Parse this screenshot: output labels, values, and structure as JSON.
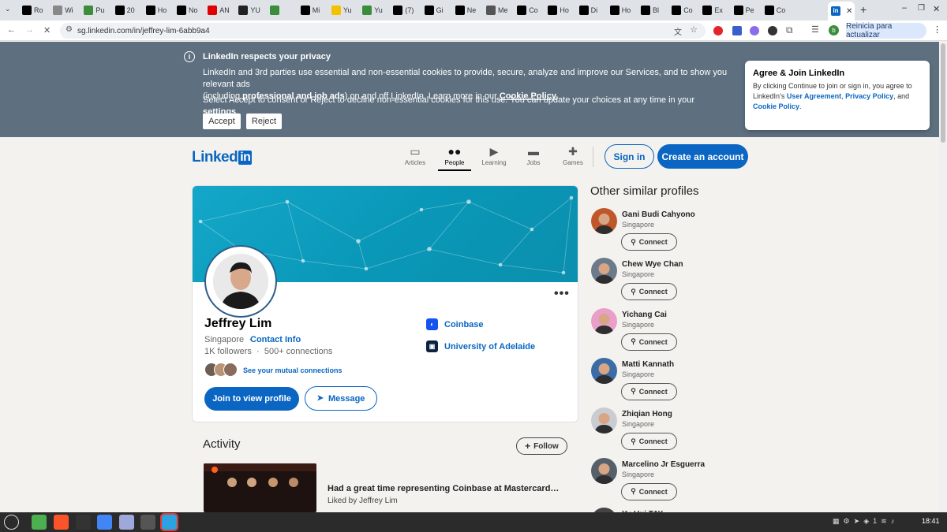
{
  "browser": {
    "tabs": [
      {
        "label": "Ro",
        "icon": "x-icon",
        "color": "#000000"
      },
      {
        "label": "Wi",
        "icon": "wikipedia-icon",
        "color": "#888888"
      },
      {
        "label": "Pu",
        "icon": "puzzle-icon",
        "color": "#3b8c3b"
      },
      {
        "label": "20",
        "icon": "x-circle-icon",
        "color": "#000000"
      },
      {
        "label": "Ho",
        "icon": "x-icon",
        "color": "#000000"
      },
      {
        "label": "No",
        "icon": "x-icon",
        "color": "#000000"
      },
      {
        "label": "AN",
        "icon": "youtube-icon",
        "color": "#e00000"
      },
      {
        "label": "YU",
        "icon": "threads-icon",
        "color": "#222222"
      },
      {
        "label": "",
        "icon": "puzzle-icon",
        "color": "#3b8c3b"
      },
      {
        "label": "Mi",
        "icon": "x-icon",
        "color": "#000000"
      },
      {
        "label": "Yu",
        "icon": "notes-icon",
        "color": "#f2c200"
      },
      {
        "label": "Yu",
        "icon": "puzzle-icon",
        "color": "#3b8c3b"
      },
      {
        "label": "(7)",
        "icon": "tiktok-icon",
        "color": "#000000"
      },
      {
        "label": "Gi",
        "icon": "x-icon",
        "color": "#000000"
      },
      {
        "label": "Ne",
        "icon": "x-icon",
        "color": "#000000"
      },
      {
        "label": "Me",
        "icon": "globe-icon",
        "color": "#555555"
      },
      {
        "label": "Co",
        "icon": "x-icon",
        "color": "#000000"
      },
      {
        "label": "Ho",
        "icon": "x-icon",
        "color": "#000000"
      },
      {
        "label": "Di",
        "icon": "x-icon",
        "color": "#000000"
      },
      {
        "label": "Ho",
        "icon": "x-icon",
        "color": "#000000"
      },
      {
        "label": "Bl",
        "icon": "x-icon",
        "color": "#000000"
      },
      {
        "label": "Co",
        "icon": "x-icon",
        "color": "#000000"
      },
      {
        "label": "Ex",
        "icon": "x-icon",
        "color": "#000000"
      },
      {
        "label": "Pe",
        "icon": "x-icon",
        "color": "#000000"
      },
      {
        "label": "Co",
        "icon": "x-icon",
        "color": "#000000"
      }
    ],
    "active_tab_icon": "linkedin-icon",
    "new_tab": "+",
    "url": "sg.linkedin.com/in/jeffrey-lim-6abb9a4",
    "restart_label": "Reinicia para actualizar",
    "profile_initial": "b"
  },
  "cookie_banner": {
    "title": "LinkedIn respects your privacy",
    "line1": "LinkedIn and 3rd parties use essential and non-essential cookies to provide, secure, analyze and improve our Services, and to show you relevant ads",
    "line2_pre": "(including ",
    "line2_bold": "professional and job ads",
    "line2_mid": ") on and off LinkedIn. Learn more in our ",
    "line2_link": "Cookie Policy",
    "line2_end": ".",
    "line3_pre": "Select Accept to consent or Reject to decline non-essential cookies for this use. You can update your choices at any time in your ",
    "line3_link": "settings",
    "line3_end": ".",
    "accept": "Accept",
    "reject": "Reject"
  },
  "join_card": {
    "title": "Agree & Join LinkedIn",
    "text_pre": "By clicking Continue to join or sign in, you agree to LinkedIn’s ",
    "link1": "User Agreement",
    "sep1": ", ",
    "link2": "Privacy Policy",
    "sep2": ", and ",
    "link3": "Cookie Policy",
    "end": "."
  },
  "nav": {
    "logo_text": "Linked",
    "logo_in": "in",
    "items": [
      {
        "label": "Articles",
        "icon": "articles-icon"
      },
      {
        "label": "People",
        "icon": "people-icon"
      },
      {
        "label": "Learning",
        "icon": "learning-icon"
      },
      {
        "label": "Jobs",
        "icon": "jobs-icon"
      },
      {
        "label": "Games",
        "icon": "games-icon"
      }
    ],
    "active": "People",
    "sign_in": "Sign in",
    "create_account": "Create an account"
  },
  "profile": {
    "name": "Jeffrey Lim",
    "location": "Singapore",
    "separator": "·",
    "contact_info": "Contact Info",
    "followers": "1K followers",
    "connections": "500+ connections",
    "mutual_text": "See your mutual connections",
    "join_to_view": "Join to view profile",
    "message": "Message",
    "more": "•••",
    "experience": [
      {
        "name": "Coinbase",
        "logo_color": "#1652f0"
      },
      {
        "name": "University of Adelaide",
        "logo_color": "#0b2341"
      }
    ]
  },
  "activity": {
    "title": "Activity",
    "follow": "Follow",
    "post_title": "Had a great time representing Coinbase at Mastercard…",
    "post_liked": "Liked by Jeffrey Lim"
  },
  "similar": {
    "title": "Other similar profiles",
    "connect_label": "Connect",
    "profiles": [
      {
        "name": "Gani Budi Cahyono",
        "location": "Singapore",
        "color": "#c0572a"
      },
      {
        "name": "Chew Wye Chan",
        "location": "Singapore",
        "color": "#6b7b8c"
      },
      {
        "name": "Yichang Cai",
        "location": "Singapore",
        "color": "#e8a0c8"
      },
      {
        "name": "Matti Kannath",
        "location": "Singapore",
        "color": "#3b6ca6"
      },
      {
        "name": "Zhiqian Hong",
        "location": "Singapore",
        "color": "#c9ccd1"
      },
      {
        "name": "Marcelino Jr Esguerra",
        "location": "Singapore",
        "color": "#55606b"
      },
      {
        "name": "Yu Hui TAY",
        "location": "",
        "color": "#444444"
      }
    ]
  },
  "taskbar": {
    "apps": [
      "mint-menu-icon",
      "files-icon",
      "brave-icon",
      "terminal-icon",
      "chrome-icon",
      "notes-icon",
      "calculator-icon",
      "telegram-icon"
    ],
    "tray_num": "1",
    "time": "18:41"
  }
}
